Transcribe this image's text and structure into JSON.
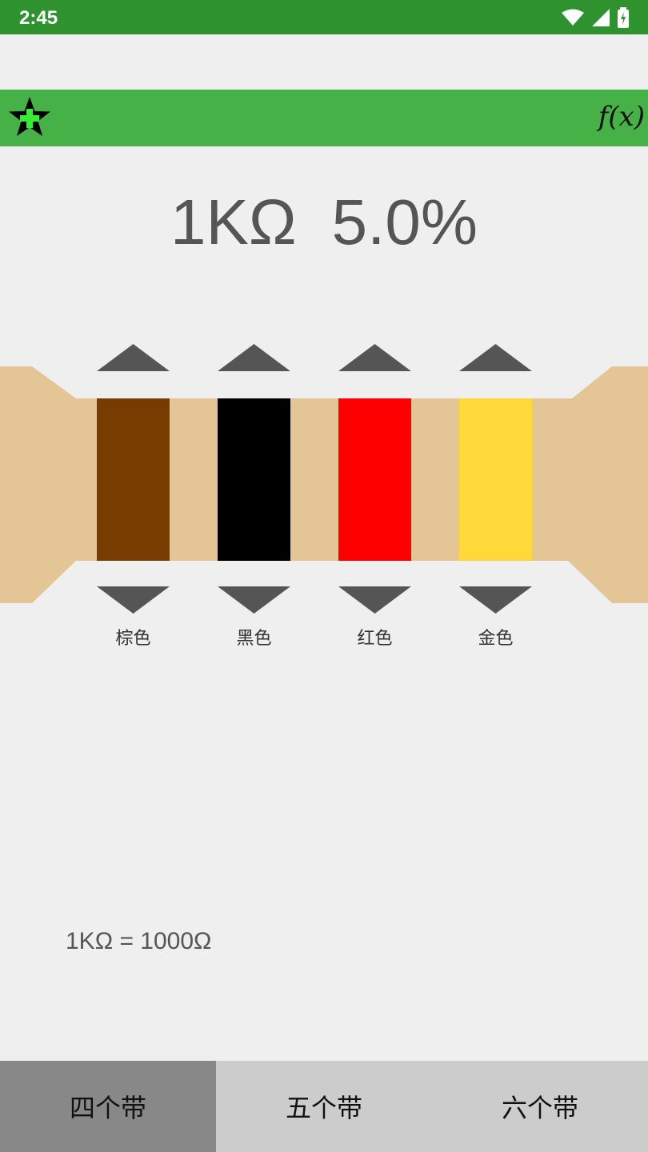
{
  "status_bar": {
    "time": "2:45"
  },
  "toolbar": {
    "fx_label": "f(x)"
  },
  "result": {
    "resistance": "1KΩ",
    "tolerance": "5.0%"
  },
  "bands": [
    {
      "label": "棕色",
      "color": "#773c00"
    },
    {
      "label": "黑色",
      "color": "#000000"
    },
    {
      "label": "红色",
      "color": "#ff0000"
    },
    {
      "label": "金色",
      "color": "#ffd93a"
    }
  ],
  "resistor_body_color": "#e4c595",
  "conversion": "1KΩ = 1000Ω",
  "tabs": [
    {
      "label": "四个带",
      "active": true
    },
    {
      "label": "五个带",
      "active": false
    },
    {
      "label": "六个带",
      "active": false
    }
  ]
}
